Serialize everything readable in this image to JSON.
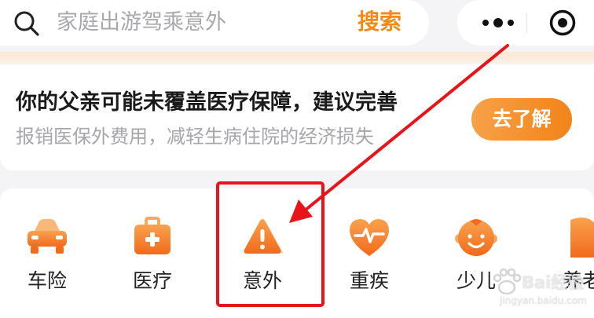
{
  "search": {
    "placeholder": "家庭出游驾乘意外",
    "button_label": "搜索"
  },
  "capsule": {
    "more_icon": "more-dots-icon",
    "close_icon": "target-circle-icon"
  },
  "promo": {
    "title": "你的父亲可能未覆盖医疗保障，建议完善",
    "subtitle": "报销医保外费用，减轻生病住院的经济损失",
    "button_label": "去了解"
  },
  "categories": [
    {
      "label": "车险",
      "icon": "car-icon"
    },
    {
      "label": "医疗",
      "icon": "medical-kit-icon"
    },
    {
      "label": "意外",
      "icon": "warning-icon"
    },
    {
      "label": "重疾",
      "icon": "heart-pulse-icon"
    },
    {
      "label": "少儿",
      "icon": "baby-face-icon"
    },
    {
      "label": "养老",
      "icon": "elderly-icon"
    }
  ],
  "annotation": {
    "highlighted_category": "意外",
    "color": "#e8141a"
  },
  "watermark": {
    "brand": "Bai经验",
    "url": "jingyan.baidu.com"
  },
  "colors": {
    "accent_orange": "#f28a1a",
    "icon_orange": "#f5832a",
    "annotation_red": "#e8141a"
  }
}
